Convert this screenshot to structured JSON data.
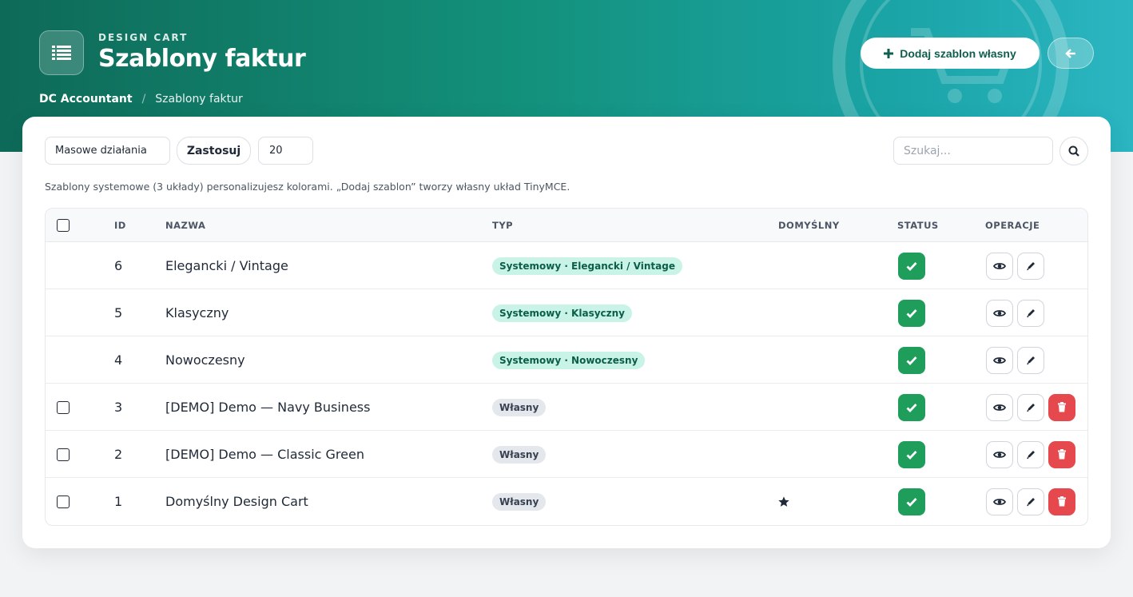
{
  "header": {
    "eyebrow": "DESIGN CART",
    "title": "Szablony faktur",
    "add_button": "Dodaj szablon własny",
    "breadcrumb": [
      "DC Accountant",
      "Szablony faktur"
    ]
  },
  "toolbar": {
    "bulk_select": "Masowe działania",
    "apply": "Zastosuj",
    "per_page": "20",
    "search_placeholder": "Szukaj..."
  },
  "note": "Szablony systemowe (3 układy) personalizujesz kolorami. „Dodaj szablon” tworzy własny układ TinyMCE.",
  "columns": [
    "ID",
    "NAZWA",
    "TYP",
    "DOMYŚLNY",
    "STATUS",
    "OPERACJE"
  ],
  "rows": [
    {
      "id": "6",
      "name": "Elegancki / Vintage",
      "type": "Systemowy · Elegancki / Vintage",
      "kind": "system",
      "default": false,
      "selectable": false,
      "deletable": false
    },
    {
      "id": "5",
      "name": "Klasyczny",
      "type": "Systemowy · Klasyczny",
      "kind": "system",
      "default": false,
      "selectable": false,
      "deletable": false
    },
    {
      "id": "4",
      "name": "Nowoczesny",
      "type": "Systemowy · Nowoczesny",
      "kind": "system",
      "default": false,
      "selectable": false,
      "deletable": false
    },
    {
      "id": "3",
      "name": "[DEMO] Demo — Navy Business",
      "type": "Własny",
      "kind": "own",
      "default": false,
      "selectable": true,
      "deletable": true
    },
    {
      "id": "2",
      "name": "[DEMO] Demo — Classic Green",
      "type": "Własny",
      "kind": "own",
      "default": false,
      "selectable": true,
      "deletable": true
    },
    {
      "id": "1",
      "name": "Domyślny Design Cart",
      "type": "Własny",
      "kind": "own",
      "default": true,
      "selectable": true,
      "deletable": true
    }
  ],
  "icons": {
    "header": "list-icon",
    "add": "plus-icon",
    "back": "arrow-left-icon",
    "search": "search-icon",
    "status": "check-icon",
    "view": "eye-icon",
    "edit": "pencil-icon",
    "delete": "trash-icon",
    "default": "star-icon"
  },
  "colors": {
    "accent": "#13907a",
    "status_active": "#1f9d5a",
    "danger": "#e5484d",
    "system_badge_bg": "#c9f3e6",
    "own_badge_bg": "#e4e7eb"
  }
}
